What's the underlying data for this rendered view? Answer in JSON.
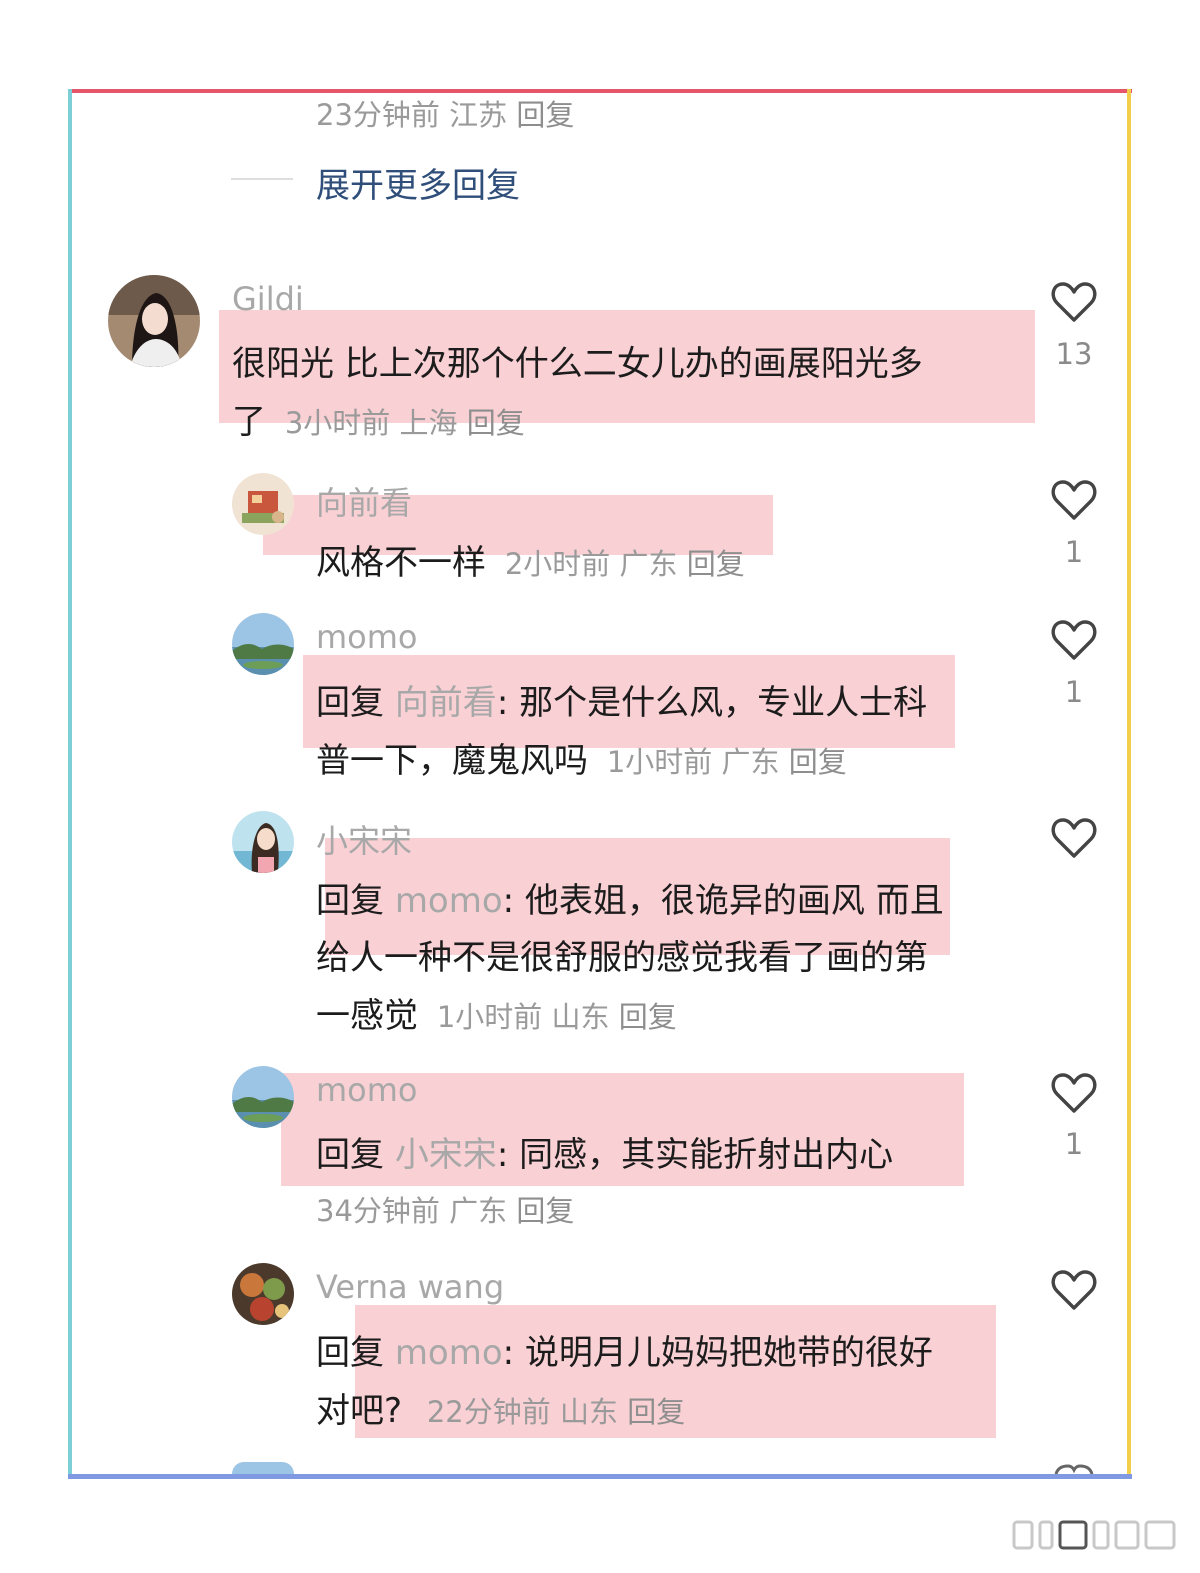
{
  "top_meta": {
    "time": "23分钟前",
    "location": "江苏",
    "reply": "回复"
  },
  "expand_more": "展开更多回复",
  "comments": [
    {
      "username": "Gildi",
      "text_line1": "很阳光 比上次那个什么二女儿办的画展阳光多",
      "text_line2": "了",
      "time": "3小时前",
      "location": "上海",
      "reply": "回复",
      "likes": "13",
      "avatar": "woman-portrait-avatar"
    },
    {
      "username": "向前看",
      "text": "风格不一样",
      "time": "2小时前",
      "location": "广东",
      "reply": "回复",
      "likes": "1",
      "avatar": "room-illustration-avatar"
    },
    {
      "username": "momo",
      "reply_prefix": "回复",
      "mention": "向前看",
      "text_line1": ": 那个是什么风，专业人士科",
      "text_line2": "普一下，魔鬼风吗",
      "time": "1小时前",
      "location": "广东",
      "reply": "回复",
      "likes": "1",
      "avatar": "landscape-avatar"
    },
    {
      "username": "小宋宋",
      "reply_prefix": "回复",
      "mention": "momo",
      "text_line1": ": 他表姐，很诡异的画风 而且",
      "text_line2": "给人一种不是很舒服的感觉我看了画的第",
      "text_line3": "一感觉",
      "time": "1小时前",
      "location": "山东",
      "reply": "回复",
      "likes": "",
      "avatar": "anime-girl-avatar"
    },
    {
      "username": "momo",
      "reply_prefix": "回复",
      "mention": "小宋宋",
      "text_line1": ": 同感，其实能折射出内心",
      "time": "34分钟前",
      "location": "广东",
      "reply": "回复",
      "likes": "1",
      "avatar": "landscape-avatar"
    },
    {
      "username": "Verna wang",
      "reply_prefix": "回复",
      "mention": "momo",
      "text_line1": ": 说明月儿妈妈把她带的很好",
      "text_line2": "对吧?",
      "time": "22分钟前",
      "location": "山东",
      "reply": "回复",
      "likes": "",
      "avatar": "food-photo-avatar"
    }
  ],
  "colors": {
    "frame_top": "#e5566a",
    "frame_left": "#7ccfd6",
    "frame_right": "#f2cf4a",
    "frame_bottom": "#7f9ae3",
    "highlight": "#f296a0",
    "link": "#2f4e7a"
  }
}
